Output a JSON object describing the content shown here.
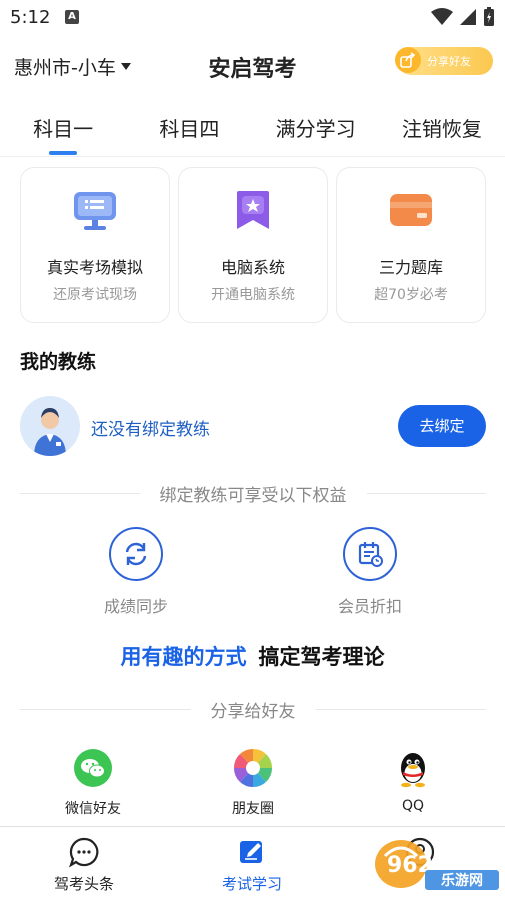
{
  "status": {
    "time": "5:12"
  },
  "header": {
    "city": "惠州市-小车",
    "title": "安启驾考",
    "share_label": "分享好友"
  },
  "tabs": [
    {
      "label": "科目一",
      "active": true
    },
    {
      "label": "科目四",
      "active": false
    },
    {
      "label": "满分学习",
      "active": false
    },
    {
      "label": "注销恢复",
      "active": false
    }
  ],
  "cards": [
    {
      "title": "真实考场模拟",
      "subtitle": "还原考试现场",
      "icon": "monitor-icon"
    },
    {
      "title": "电脑系统",
      "subtitle": "开通电脑系统",
      "icon": "bookmark-star-icon"
    },
    {
      "title": "三力题库",
      "subtitle": "超70岁必考",
      "icon": "card-icon"
    }
  ],
  "coach": {
    "section_title": "我的教练",
    "status_text": "还没有绑定教练",
    "bind_button": "去绑定",
    "benefits_title": "绑定教练可享受以下权益",
    "benefits": [
      {
        "label": "成绩同步",
        "icon": "sync-icon"
      },
      {
        "label": "会员折扣",
        "icon": "calendar-discount-icon"
      }
    ]
  },
  "slogan": {
    "blue": "用有趣的方式",
    "black": "搞定驾考理论"
  },
  "share": {
    "title": "分享给好友",
    "items": [
      {
        "label": "微信好友",
        "icon": "wechat-icon"
      },
      {
        "label": "朋友圈",
        "icon": "moments-icon"
      },
      {
        "label": "QQ",
        "icon": "qq-icon"
      }
    ]
  },
  "bottom_nav": [
    {
      "label": "驾考头条",
      "icon": "chat-bubble-icon",
      "active": false
    },
    {
      "label": "考试学习",
      "icon": "edit-icon",
      "active": true
    },
    {
      "label": "",
      "icon": "profile-icon",
      "active": false
    }
  ],
  "watermark": {
    "text_top": "962.NET",
    "text_bottom": "乐游网"
  },
  "colors": {
    "accent": "#1a63e6",
    "tab_indicator": "#2e7ff0",
    "share_button": "#fbc850"
  }
}
